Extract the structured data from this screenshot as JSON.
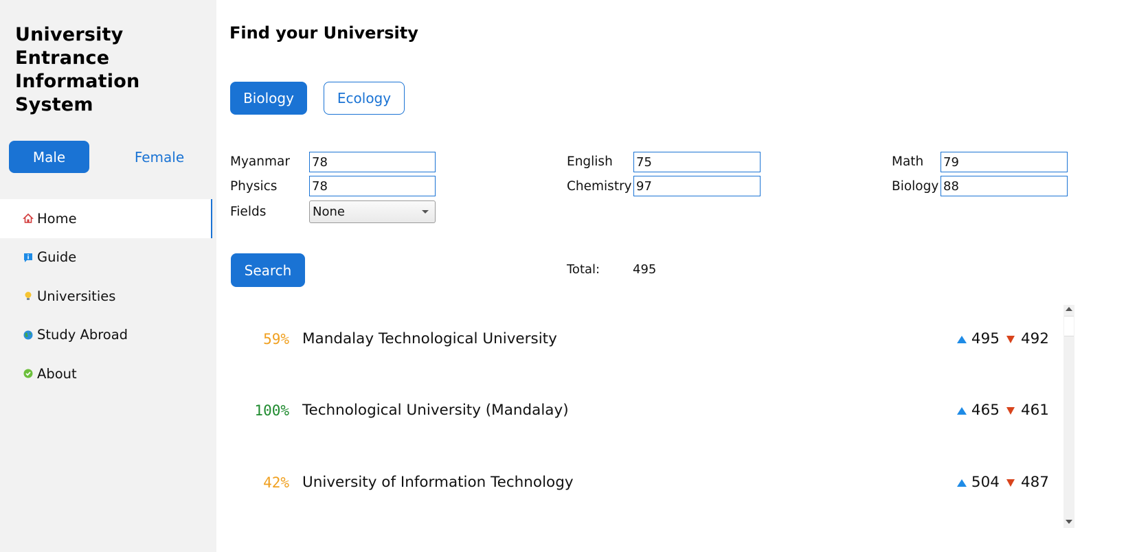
{
  "app": {
    "title": "University Entrance Information System"
  },
  "gender": {
    "male": "Male",
    "female": "Female",
    "selected": "Male"
  },
  "nav": {
    "items": [
      {
        "label": "Home",
        "icon": "home-icon",
        "active": true
      },
      {
        "label": "Guide",
        "icon": "info-icon",
        "active": false
      },
      {
        "label": "Universities",
        "icon": "lightbulb-icon",
        "active": false
      },
      {
        "label": "Study Abroad",
        "icon": "globe-icon",
        "active": false
      },
      {
        "label": "About",
        "icon": "check-icon",
        "active": false
      }
    ]
  },
  "main": {
    "title": "Find your University",
    "fields": {
      "biology": "Biology",
      "ecology": "Ecology",
      "selected": "Biology"
    },
    "subjects": {
      "myanmar": {
        "label": "Myanmar",
        "value": "78"
      },
      "english": {
        "label": "English",
        "value": "75"
      },
      "math": {
        "label": "Math",
        "value": "79"
      },
      "physics": {
        "label": "Physics",
        "value": "78"
      },
      "chemistry": {
        "label": "Chemistry",
        "value": "97"
      },
      "biology": {
        "label": "Biology",
        "value": "88"
      }
    },
    "fields_select": {
      "label": "Fields",
      "value": "None"
    },
    "search_label": "Search",
    "total": {
      "label": "Total:",
      "value": "495"
    }
  },
  "results": [
    {
      "percent": "59%",
      "name": "Mandalay Technological University",
      "max": "495",
      "min": "492",
      "color": "#f0a020"
    },
    {
      "percent": "100%",
      "name": "Technological University (Mandalay)",
      "max": "465",
      "min": "461",
      "color": "#1e8a2e"
    },
    {
      "percent": "42%",
      "name": "University of Information Technology",
      "max": "504",
      "min": "487",
      "color": "#f0a020"
    }
  ],
  "colors": {
    "accent": "#1a73d4",
    "up": "#1e8be6",
    "down": "#d8441c",
    "sidebar_bg": "#f2f2f2"
  }
}
